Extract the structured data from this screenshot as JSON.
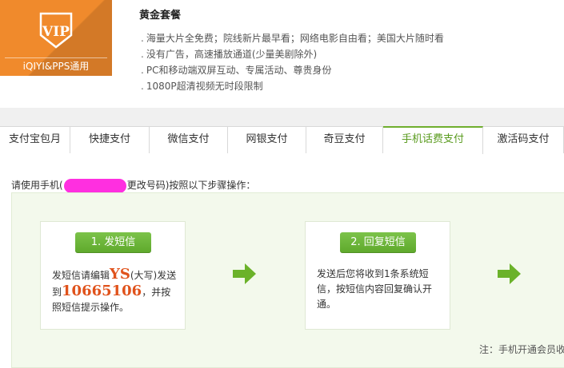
{
  "package": {
    "badge_text": "VIP",
    "badge_caption": "iQIYI&PPS通用",
    "title": "黄金套餐",
    "features": [
      "海量大片全免费；院线新片最早看；网络电影自由看；美国大片随时看",
      "没有广告，高速播放通道(少量美剧除外)",
      "PC和移动端双屏互动、专属活动、尊贵身份",
      "1080P超清视频无时段限制"
    ]
  },
  "tabs": [
    {
      "label": "支付宝包月",
      "active": false
    },
    {
      "label": "快捷支付",
      "active": false
    },
    {
      "label": "微信支付",
      "active": false
    },
    {
      "label": "网银支付",
      "active": false
    },
    {
      "label": "奇豆支付",
      "active": false
    },
    {
      "label": "手机话费支付",
      "active": true
    },
    {
      "label": "激活码支付",
      "active": false
    }
  ],
  "instruction": {
    "prefix": "请使用手机(",
    "suffix": "更改号码)按照以下步骤操作："
  },
  "steps": [
    {
      "button_label": "1. 发短信",
      "text_1": "发短信请编辑",
      "code": "YS",
      "text_2": "(大写)发送到",
      "number": "10665106",
      "text_3": "，并按照短信提示操作。"
    },
    {
      "button_label": "2. 回复短信",
      "text": "发送后您将收到1条系统短信，按短信内容回复确认开通。"
    }
  ],
  "note": "注：手机开通会员收",
  "colors": {
    "vip_orange": "#f08a2c",
    "accent_green": "#6fae2e",
    "highlight_orange": "#e0521b",
    "mask_magenta": "#ff2fe0"
  }
}
